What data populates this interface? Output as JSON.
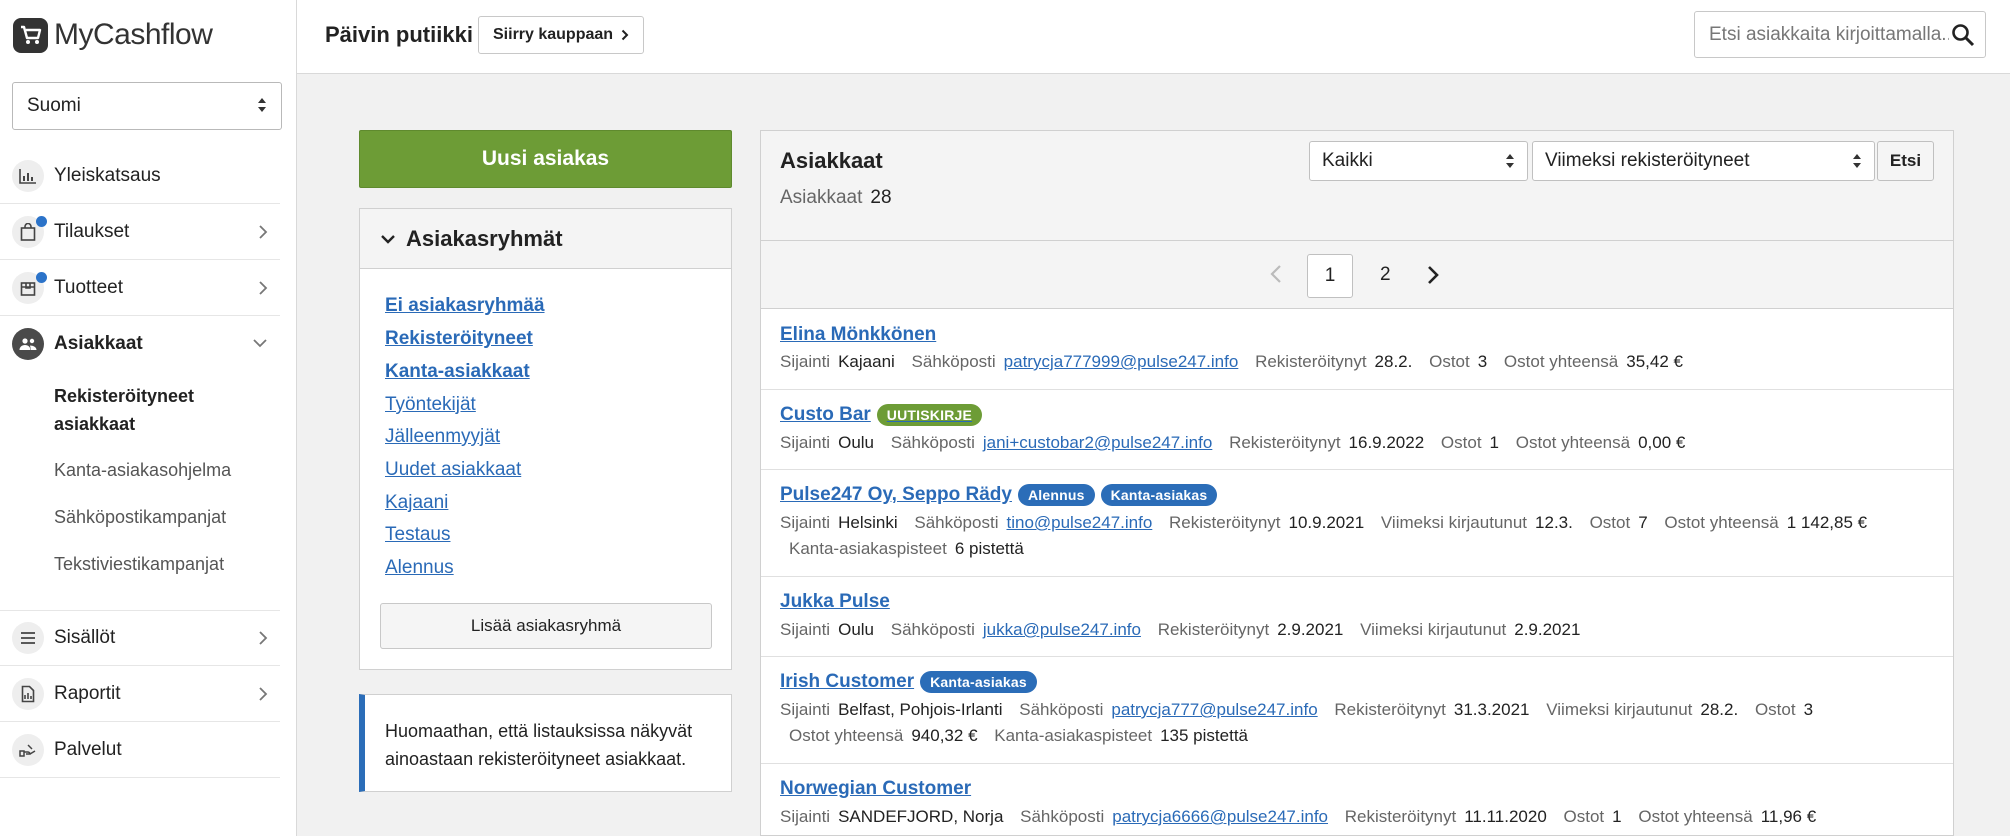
{
  "brand": "MyCashflow",
  "language": "Suomi",
  "nav": {
    "overview": "Yleiskatsaus",
    "orders": "Tilaukset",
    "products": "Tuotteet",
    "customers": "Asiakkaat",
    "sub": [
      "Rekisteröityneet asiakkaat",
      "Kanta-asiakasohjelma",
      "Sähköpostikampanjat",
      "Tekstiviestikampanjat"
    ],
    "contents": "Sisällöt",
    "reports": "Raportit",
    "services": "Palvelut"
  },
  "topbar": {
    "shop_name": "Päivin putiikki",
    "go_shop": "Siirry kauppaan",
    "search_placeholder": "Etsi asiakkaita kirjoittamalla..."
  },
  "new_customer": "Uusi asiakas",
  "groups": {
    "title": "Asiakasryhmät",
    "items": [
      "Ei asiakasryhmää",
      "Rekisteröityneet",
      "Kanta-asiakkaat",
      "Työntekijät",
      "Jälleenmyyjät",
      "Uudet asiakkaat",
      "Kajaani",
      "Testaus",
      "Alennus"
    ],
    "add": "Lisää asiakasryhmä"
  },
  "note": "Huomaathan, että listauksissa näkyvät ainoastaan rekisteröityneet asiakkaat.",
  "customers": {
    "title": "Asiakkaat",
    "count_label": "Asiakkaat",
    "count": "28",
    "filter": "Kaikki",
    "sort": "Viimeksi rekisteröityneet",
    "search_btn": "Etsi",
    "pages": [
      "1",
      "2"
    ],
    "labels": {
      "location": "Sijainti",
      "email": "Sähköposti",
      "registered": "Rekisteröitynyt",
      "last_login": "Viimeksi kirjautunut",
      "orders": "Ostot",
      "total": "Ostot yhteensä",
      "points": "Kanta-asiakaspisteet"
    },
    "rows": [
      {
        "name": "Elina Mönkkönen",
        "location": "Kajaani",
        "email": "patrycja777999@pulse247.info",
        "registered": "28.2.",
        "orders": "3",
        "total": "35,42 €"
      },
      {
        "name": "Custo Bar",
        "tag": "UUTISKIRJE",
        "location": "Oulu",
        "email": "jani+custobar2@pulse247.info",
        "registered": "16.9.2022",
        "orders": "1",
        "total": "0,00 €"
      },
      {
        "name": "Pulse247 Oy, Seppo Rädy",
        "tags": [
          "Alennus",
          "Kanta-asiakas"
        ],
        "location": "Helsinki",
        "email": "tino@pulse247.info",
        "registered": "10.9.2021",
        "last_login": "12.3.",
        "orders": "7",
        "total": "1 142,85 €",
        "points": "6 pistettä"
      },
      {
        "name": "Jukka Pulse",
        "location": "Oulu",
        "email": "jukka@pulse247.info",
        "registered": "2.9.2021",
        "last_login": "2.9.2021"
      },
      {
        "name": "Irish Customer",
        "tag": "Kanta-asiakas",
        "location": "Belfast, Pohjois-Irlanti",
        "email": "patrycja777@pulse247.info",
        "registered": "31.3.2021",
        "last_login": "28.2.",
        "orders": "3",
        "total": "940,32 €",
        "points": "135 pistettä"
      },
      {
        "name": "Norwegian Customer",
        "location": "SANDEFJORD, Norja",
        "email": "patrycja6666@pulse247.info",
        "registered": "11.11.2020",
        "orders": "1",
        "total": "11,96 €"
      }
    ]
  }
}
